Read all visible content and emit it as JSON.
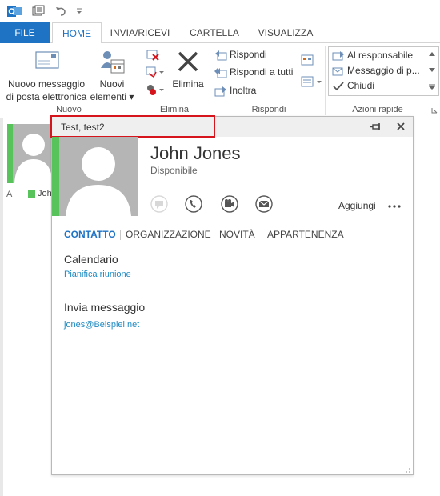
{
  "ribbon_tabs": {
    "file": "FILE",
    "home": "HOME",
    "send_receive": "INVIA/RICEVI",
    "folder": "CARTELLA",
    "view": "VISUALIZZA"
  },
  "ribbon": {
    "new_email_line1": "Nuovo messaggio",
    "new_email_line2": "di posta elettronica",
    "new_items_line1": "Nuovi",
    "new_items_line2": "elementi ▾",
    "group_new": "Nuovo",
    "delete": "Elimina",
    "group_delete": "Elimina",
    "reply": "Rispondi",
    "reply_all": "Rispondi a tutti",
    "forward": "Inoltra",
    "group_respond": "Rispondi",
    "quick_steps": [
      "Al responsabile",
      "Messaggio di p...",
      "Chiudi"
    ],
    "group_quick_steps": "Azioni rapide"
  },
  "background": {
    "letter": "A",
    "name_fragment": "Joh"
  },
  "card": {
    "title": "Test, test2",
    "name": "John Jones",
    "status": "Disponibile",
    "add_label": "Aggiungi",
    "tabs": [
      "CONTATTO",
      "ORGANIZZAZIONE",
      "NOVITÀ",
      "APPARTENENZA"
    ],
    "calendar_heading": "Calendario",
    "calendar_link": "Pianifica riunione",
    "message_heading": "Invia messaggio",
    "email": "jones@Beispiel.net"
  },
  "colors": {
    "accent_blue": "#1e73c5",
    "presence_green": "#57c35a",
    "highlight_red": "#d6141b"
  }
}
